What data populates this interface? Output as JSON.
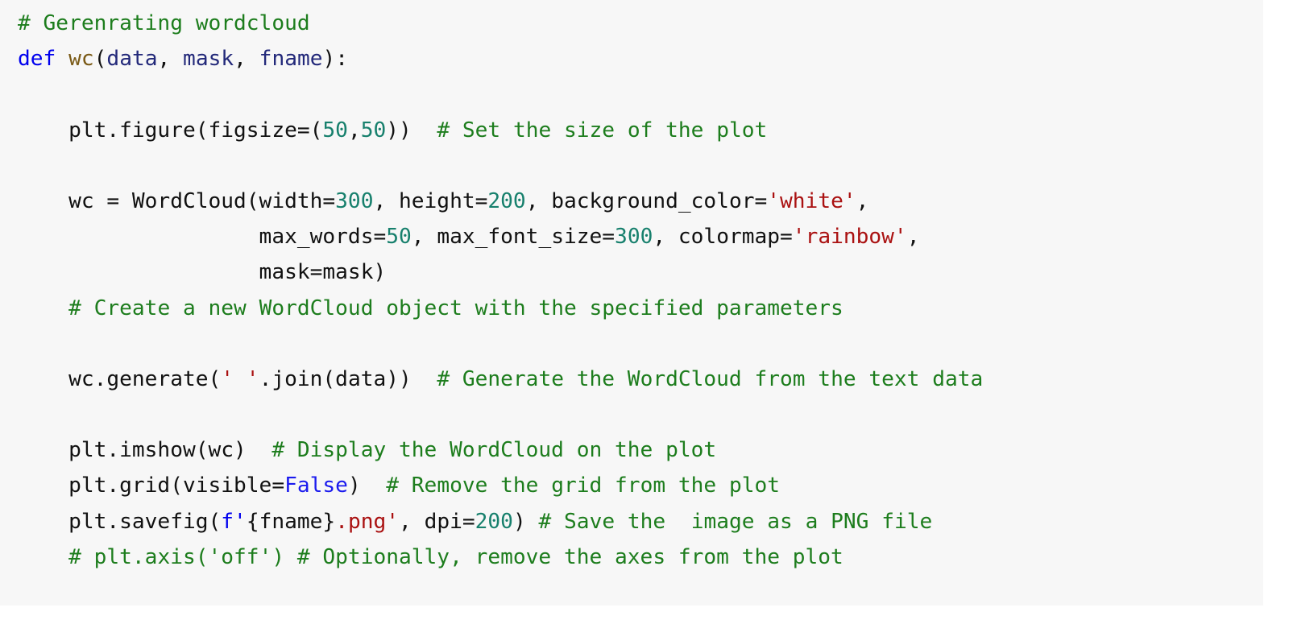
{
  "code_lines": [
    [
      {
        "t": "# Gerenrating wordcloud",
        "c": "com"
      }
    ],
    [
      {
        "t": "def",
        "c": "kw"
      },
      {
        "t": " "
      },
      {
        "t": "wc",
        "c": "fn"
      },
      {
        "t": "("
      },
      {
        "t": "data",
        "c": "var"
      },
      {
        "t": ", "
      },
      {
        "t": "mask",
        "c": "var"
      },
      {
        "t": ", "
      },
      {
        "t": "fname",
        "c": "var"
      },
      {
        "t": "):"
      }
    ],
    [],
    [
      {
        "t": "    plt.figure(figsize=("
      },
      {
        "t": "50",
        "c": "num"
      },
      {
        "t": ","
      },
      {
        "t": "50",
        "c": "num"
      },
      {
        "t": "))  "
      },
      {
        "t": "# Set the size of the plot",
        "c": "com"
      }
    ],
    [],
    [
      {
        "t": "    wc = WordCloud(width="
      },
      {
        "t": "300",
        "c": "num"
      },
      {
        "t": ", height="
      },
      {
        "t": "200",
        "c": "num"
      },
      {
        "t": ", background_color="
      },
      {
        "t": "'white'",
        "c": "str"
      },
      {
        "t": ","
      }
    ],
    [
      {
        "t": "                   max_words="
      },
      {
        "t": "50",
        "c": "num"
      },
      {
        "t": ", max_font_size="
      },
      {
        "t": "300",
        "c": "num"
      },
      {
        "t": ", colormap="
      },
      {
        "t": "'rainbow'",
        "c": "str"
      },
      {
        "t": ","
      }
    ],
    [
      {
        "t": "                   mask=mask)"
      }
    ],
    [
      {
        "t": "    "
      },
      {
        "t": "# Create a new WordCloud object with the specified parameters",
        "c": "com"
      }
    ],
    [],
    [
      {
        "t": "    wc.generate("
      },
      {
        "t": "' '",
        "c": "str"
      },
      {
        "t": ".join(data))  "
      },
      {
        "t": "# Generate the WordCloud from the text data",
        "c": "com"
      }
    ],
    [],
    [
      {
        "t": "    plt.imshow(wc)  "
      },
      {
        "t": "# Display the WordCloud on the plot",
        "c": "com"
      }
    ],
    [
      {
        "t": "    plt.grid(visible="
      },
      {
        "t": "False",
        "c": "bool"
      },
      {
        "t": ")  "
      },
      {
        "t": "# Remove the grid from the plot",
        "c": "com"
      }
    ],
    [
      {
        "t": "    plt.savefig("
      },
      {
        "t": "f'",
        "c": "kw"
      },
      {
        "t": "{fname}"
      },
      {
        "t": ".png'",
        "c": "str"
      },
      {
        "t": ", dpi="
      },
      {
        "t": "200",
        "c": "num"
      },
      {
        "t": ") "
      },
      {
        "t": "# Save the  image as a PNG file",
        "c": "com"
      }
    ],
    [
      {
        "t": "    "
      },
      {
        "t": "# plt.axis('off') # Optionally, remove the axes from the plot",
        "c": "com"
      }
    ]
  ]
}
